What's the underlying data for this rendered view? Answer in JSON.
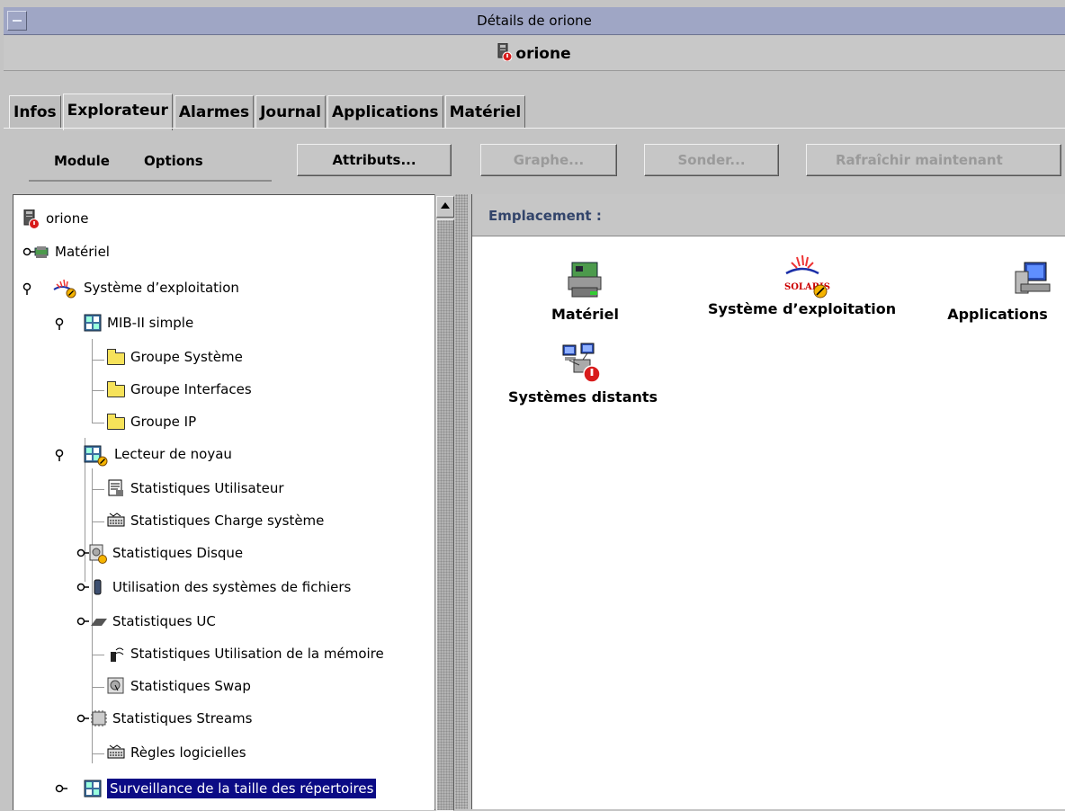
{
  "window": {
    "title": "Détails de orione"
  },
  "host": {
    "name": "orione"
  },
  "tabs": [
    "Infos",
    "Explorateur",
    "Alarmes",
    "Journal",
    "Applications",
    "Matériel"
  ],
  "active_tab": "Explorateur",
  "toolbar": {
    "module": "Module",
    "options": "Options",
    "attributes": "Attributs...",
    "graph": "Graphe...",
    "probe": "Sonder...",
    "refresh": "Rafraîchir maintenant"
  },
  "tree": {
    "root": "orione",
    "items": [
      {
        "label": "Matériel",
        "icon": "hardware-icon"
      },
      {
        "label": "Système d’exploitation",
        "icon": "os-icon"
      },
      {
        "label": "MIB-II simple",
        "icon": "module-icon"
      },
      {
        "label": "Groupe Système",
        "icon": "folder-icon"
      },
      {
        "label": "Groupe Interfaces",
        "icon": "folder-icon"
      },
      {
        "label": "Groupe IP",
        "icon": "folder-icon"
      },
      {
        "label": "Lecteur de noyau",
        "icon": "module-icon"
      },
      {
        "label": "Statistiques Utilisateur",
        "icon": "user-stats-icon"
      },
      {
        "label": "Statistiques Charge système",
        "icon": "load-icon"
      },
      {
        "label": "Statistiques Disque",
        "icon": "disk-icon"
      },
      {
        "label": "Utilisation des systèmes de fichiers",
        "icon": "filesystem-icon"
      },
      {
        "label": "Statistiques UC",
        "icon": "cpu-icon"
      },
      {
        "label": "Statistiques Utilisation de la mémoire",
        "icon": "memory-icon"
      },
      {
        "label": "Statistiques Swap",
        "icon": "swap-icon"
      },
      {
        "label": "Statistiques Streams",
        "icon": "streams-icon"
      },
      {
        "label": "Règles logicielles",
        "icon": "rules-icon"
      },
      {
        "label": "Surveillance de la taille des répertoires",
        "icon": "module-icon"
      }
    ]
  },
  "location": {
    "label": "Emplacement :"
  },
  "right_items": [
    "Matériel",
    "Système d’exploitation",
    "Applications",
    "Systèmes distants"
  ],
  "solaris_text": "SOLARIS",
  "colors": {
    "selection": "#0b0b85",
    "titlebar": "#9fa6c5",
    "location_text": "#33456b"
  }
}
